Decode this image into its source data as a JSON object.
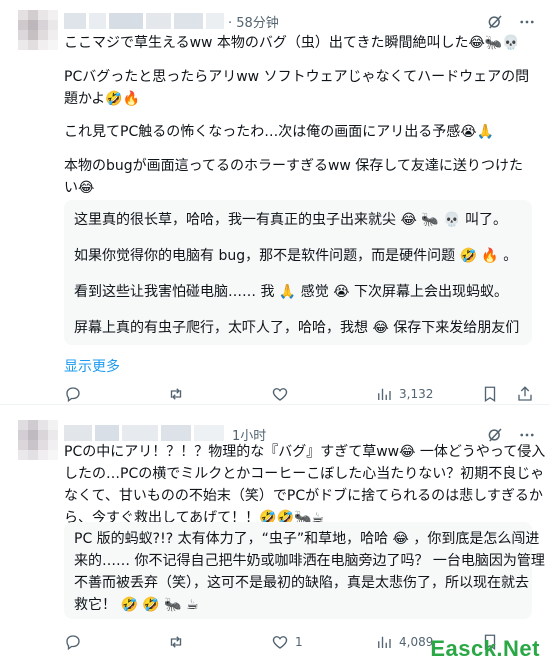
{
  "post1": {
    "time": "· 58分钟",
    "jp_paragraphs": [
      "ここマジで草生えるww 本物のバグ（虫）出てきた瞬間絶叫した😂🐜💀",
      "PCバグったと思ったらアリww ソフトウェアじゃなくてハードウェアの問題かよ🤣🔥",
      "これ見てPC触るの怖くなったわ…次は俺の画面にアリ出る予感😭🙏",
      "本物のbugが画面這ってるのホラーすぎるww 保存して友達に送りつけたい😂"
    ],
    "translation": [
      "这里真的很长草，哈哈，我一有真正的虫子出来就尖 😂 🐜 💀 叫了。",
      "如果你觉得你的电脑有 bug，那不是软件问题，而是硬件问题 🤣 🔥 。",
      "看到这些让我害怕碰电脑…… 我 🙏 感觉 😭 下次屏幕上会出现蚂蚁。",
      "屏幕上真的有虫子爬行，太吓人了，哈哈，我想 😂 保存下来发给朋友们"
    ],
    "show_more": "显示更多",
    "views": "3,132"
  },
  "post2": {
    "time": "1小时",
    "jp_lines": [
      "PCの中にアリ！？！？物理的な『バグ』すぎて草ww😂 一体どうやって侵入",
      "したの…PCの横でミルクとかコーヒーこぼした心当たりない？初期不良じゃ",
      "なくて、甘いものの不始末（笑）でPCがドブに捨てられるのは悲しすぎるか",
      "ら、今すぐ救出してあげて！！🤣🤣🐜☕"
    ],
    "translation_lines": [
      "PC 版的蚂蚁?!? 太有体力了，“虫子”和草地，哈哈 😂 ，你到底是怎么闯进",
      "来的…… 你不记得自己把牛奶或咖啡洒在电脑旁边了吗？ 一台电脑因为管理",
      "不善而被丢弃（笑），这可不是最初的缺陷，真是太悲伤了，所以现在就去",
      "救它！ 🤣 🤣 🐜 ☕"
    ],
    "likes": "1",
    "views": "4,089"
  },
  "watermark": "Easck.Net",
  "colors": {
    "link": "#1d9bf0",
    "muted": "#536471",
    "translation_bg": "#f7f9f9",
    "watermark": "#2aa845"
  }
}
